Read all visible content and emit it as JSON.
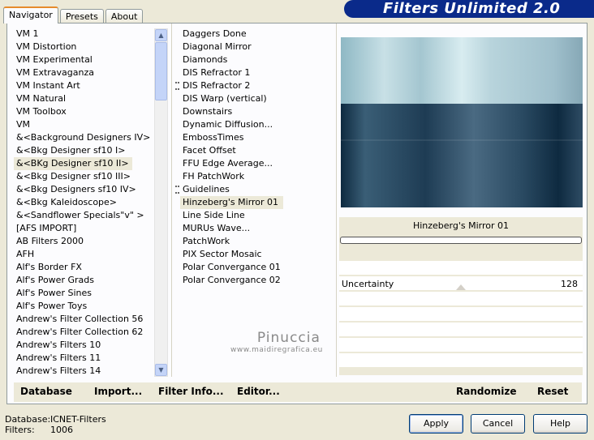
{
  "tabs": [
    "Navigator",
    "Presets",
    "About"
  ],
  "banner_title": "Filters Unlimited 2.0",
  "categories": [
    "VM 1",
    "VM Distortion",
    "VM Experimental",
    "VM Extravaganza",
    "VM Instant Art",
    "VM Natural",
    "VM Toolbox",
    "VM",
    "&<Background Designers IV>",
    "&<Bkg Designer sf10 I>",
    "&<BKg Designer sf10 II>",
    "&<Bkg Designer sf10 III>",
    "&<Bkg Designers sf10 IV>",
    "&<Bkg Kaleidoscope>",
    "&<Sandflower Specials\"v\" >",
    "[AFS IMPORT]",
    "AB Filters 2000",
    "AFH",
    "Alf's Border FX",
    "Alf's Power Grads",
    "Alf's Power Sines",
    "Alf's Power Toys",
    "Andrew's Filter Collection 56",
    "Andrew's Filter Collection 62",
    "Andrew's Filters 10",
    "Andrew's Filters 11",
    "Andrew's Filters 14"
  ],
  "selected_category_index": 10,
  "filters": [
    "Daggers Done",
    "Diagonal Mirror",
    "Diamonds",
    "DIS Refractor 1",
    "DIS Refractor 2",
    "DIS Warp (vertical)",
    "Downstairs",
    "Dynamic Diffusion...",
    "EmbossTimes",
    "Facet Offset",
    "FFU Edge Average...",
    "FH PatchWork",
    "Guidelines",
    "Hinzeberg's Mirror 01",
    "Line Side Line",
    "MURUs Wave...",
    "PatchWork",
    "PIX Sector Mosaic",
    "Polar Convergance 01",
    "Polar Convergance 02"
  ],
  "selected_filter_index": 13,
  "watermark": {
    "name": "Pinuccia",
    "site": "www.maidiregrafica.eu"
  },
  "panel": {
    "filter_name": "Hinzeberg's Mirror 01",
    "param_label": "Uncertainty",
    "param_value": "128"
  },
  "bottom_buttons": {
    "database": "Database",
    "import": "Import...",
    "filter_info": "Filter Info...",
    "editor": "Editor...",
    "randomize": "Randomize",
    "reset": "Reset"
  },
  "status": {
    "database_label": "Database:",
    "database_value": "ICNET-Filters",
    "filters_label": "Filters:",
    "filters_value": "1006"
  },
  "dialog_buttons": {
    "apply": "Apply",
    "cancel": "Cancel",
    "help": "Help"
  }
}
